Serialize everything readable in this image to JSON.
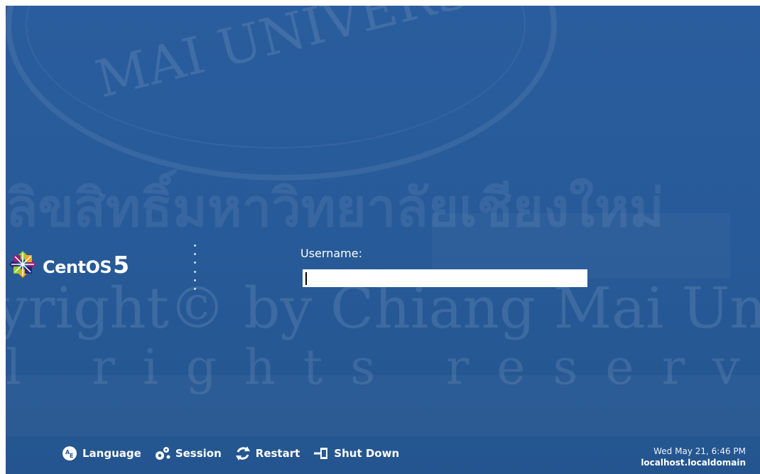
{
  "brand": {
    "name": "CentOS",
    "version": "5"
  },
  "login": {
    "username_label": "Username:",
    "username_value": ""
  },
  "actions": [
    {
      "id": "language",
      "label": "Language",
      "icon": "language-icon"
    },
    {
      "id": "session",
      "label": "Session",
      "icon": "session-icon"
    },
    {
      "id": "restart",
      "label": "Restart",
      "icon": "restart-icon"
    },
    {
      "id": "shutdown",
      "label": "Shut Down",
      "icon": "shutdown-icon"
    }
  ],
  "status": {
    "datetime": "Wed May 21,  6:46 PM",
    "hostname": "localhost.localdomain"
  },
  "watermark": {
    "university": "MAI UNIVERSITY",
    "thai": "ลิขสิทธิ์มหาวิทยาลัยเชียงใหม่",
    "copyright": "yright© by Chiang Mai University",
    "rights": "l rights reserved"
  },
  "colors": {
    "background": "#275a98",
    "input_background": "#ffffff",
    "text": "#ffffff"
  }
}
